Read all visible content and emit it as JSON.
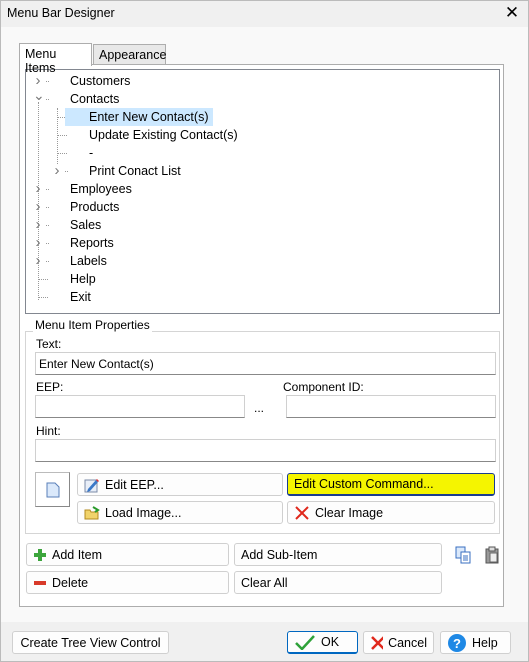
{
  "window": {
    "title": "Menu Bar Designer"
  },
  "tabs": [
    {
      "label": "Menu Items",
      "active": true
    },
    {
      "label": "Appearance",
      "active": false
    }
  ],
  "tree": {
    "items": [
      {
        "label": "Customers",
        "level": 0,
        "expander": "collapsed"
      },
      {
        "label": "Contacts",
        "level": 0,
        "expander": "expanded"
      },
      {
        "label": "Enter New Contact(s)",
        "level": 1,
        "expander": "none",
        "selected": true
      },
      {
        "label": "Update Existing Contact(s)",
        "level": 1,
        "expander": "none"
      },
      {
        "label": "-",
        "level": 1,
        "expander": "none"
      },
      {
        "label": "Print Conact List",
        "level": 1,
        "expander": "collapsed"
      },
      {
        "label": "Employees",
        "level": 0,
        "expander": "collapsed"
      },
      {
        "label": "Products",
        "level": 0,
        "expander": "collapsed"
      },
      {
        "label": "Sales",
        "level": 0,
        "expander": "collapsed"
      },
      {
        "label": "Reports",
        "level": 0,
        "expander": "collapsed"
      },
      {
        "label": "Labels",
        "level": 0,
        "expander": "collapsed"
      },
      {
        "label": "Help",
        "level": 0,
        "expander": "none"
      },
      {
        "label": "Exit",
        "level": 0,
        "expander": "none"
      }
    ]
  },
  "properties": {
    "group_label": "Menu Item Properties",
    "text_label": "Text:",
    "text_value": "Enter New Contact(s)",
    "eep_label": "EEP:",
    "eep_value": "",
    "ellipsis": "...",
    "component_label": "Component ID:",
    "component_value": "",
    "hint_label": "Hint:",
    "hint_value": "",
    "edit_eep": "Edit EEP...",
    "edit_custom": "Edit Custom Command...",
    "load_image": "Load Image...",
    "clear_image": "Clear Image"
  },
  "actions": {
    "add_item": "Add Item",
    "add_sub_item": "Add Sub-Item",
    "delete": "Delete",
    "clear_all": "Clear All"
  },
  "footer": {
    "create_tree": "Create Tree View Control",
    "ok": "OK",
    "cancel": "Cancel",
    "help": "Help"
  },
  "colors": {
    "selection": "#cce8ff",
    "highlight_button": "#f5f500",
    "accent": "#0067c0"
  }
}
